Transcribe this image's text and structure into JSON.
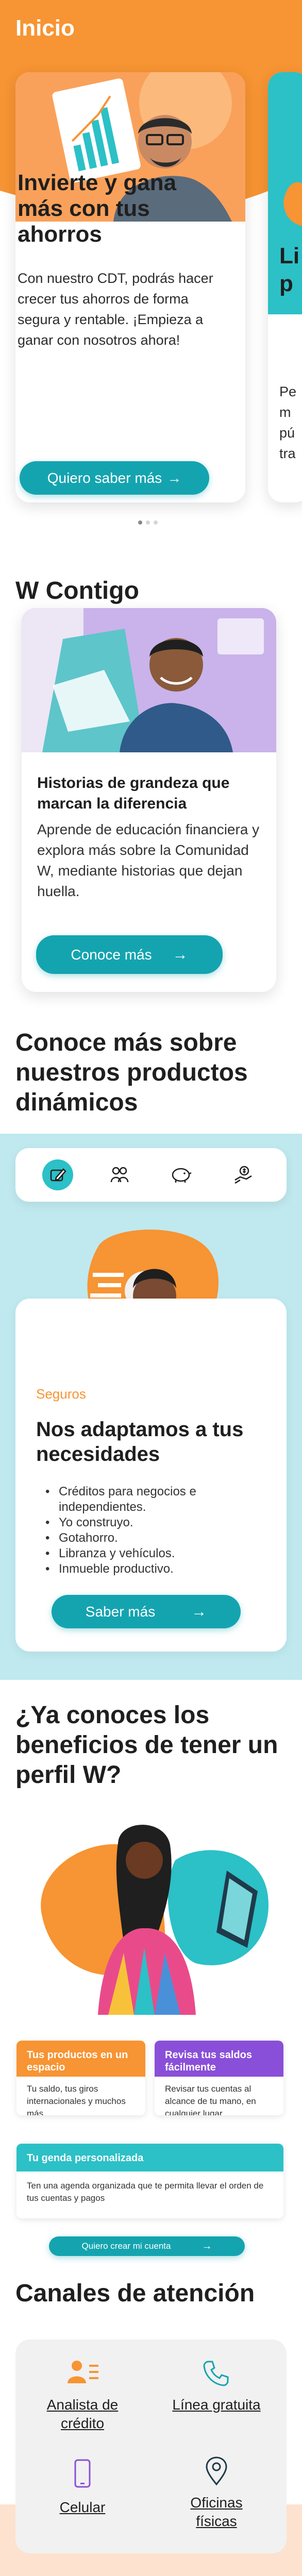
{
  "header": {
    "title": "Inicio"
  },
  "carousel": {
    "slides": [
      {
        "title": "Invierte y gana más con tus ahorros",
        "text": "Con nuestro CDT, podrás hacer crecer tus ahorros de forma segura y rentable. ¡Empieza a ganar con nosotros ahora!",
        "button": "Quiero saber más"
      },
      {
        "title": "Li\np",
        "text": "Pe\nm\npú\ntra"
      }
    ]
  },
  "w_contigo": {
    "title": "W Contigo",
    "card_title": "Historias de grandeza que marcan la diferencia",
    "card_text": "Aprende de educación financiera y explora más sobre la Comunidad W, mediante historias que dejan huella.",
    "button": "Conoce más"
  },
  "productos": {
    "title": "Conoce más sobre nuestros productos dinámicos",
    "tabs": [
      "Créditos",
      "Ahorro",
      "Seguros",
      "Inversión"
    ],
    "category": "Seguros",
    "card_title": "Nos adaptamos a tus necesidades",
    "list": [
      "Créditos para negocios e independientes.",
      "Yo construyo.",
      "Gotahorro.",
      "Libranza y vehículos.",
      "Inmueble productivo."
    ],
    "button": "Saber más"
  },
  "perfil_w": {
    "title": "¿Ya conoces los beneficios de tener un perfil W?",
    "box1_title": "Tus productos en un espacio",
    "box1_text": "Tu saldo, tus giros internacionales y muchos más",
    "box2_title": "Revisa tus saldos fácilmente",
    "box2_text": "Revisar tus cuentas al alcance de tu mano, en cualquier lugar",
    "box3_title": "Tu genda personalizada",
    "box3_text": "Ten una agenda organizada que te permita llevar el orden de tus cuentas y pagos",
    "button": "Quiero crear mi cuenta"
  },
  "canales": {
    "title": "Canales de atención",
    "items": [
      "Analista de crédito",
      "Línea gratuita",
      "Celular",
      "Oficinas físicas"
    ]
  },
  "colors": {
    "orange": "#f79433",
    "teal": "#14a4b0",
    "purple": "#8a4fd8"
  }
}
